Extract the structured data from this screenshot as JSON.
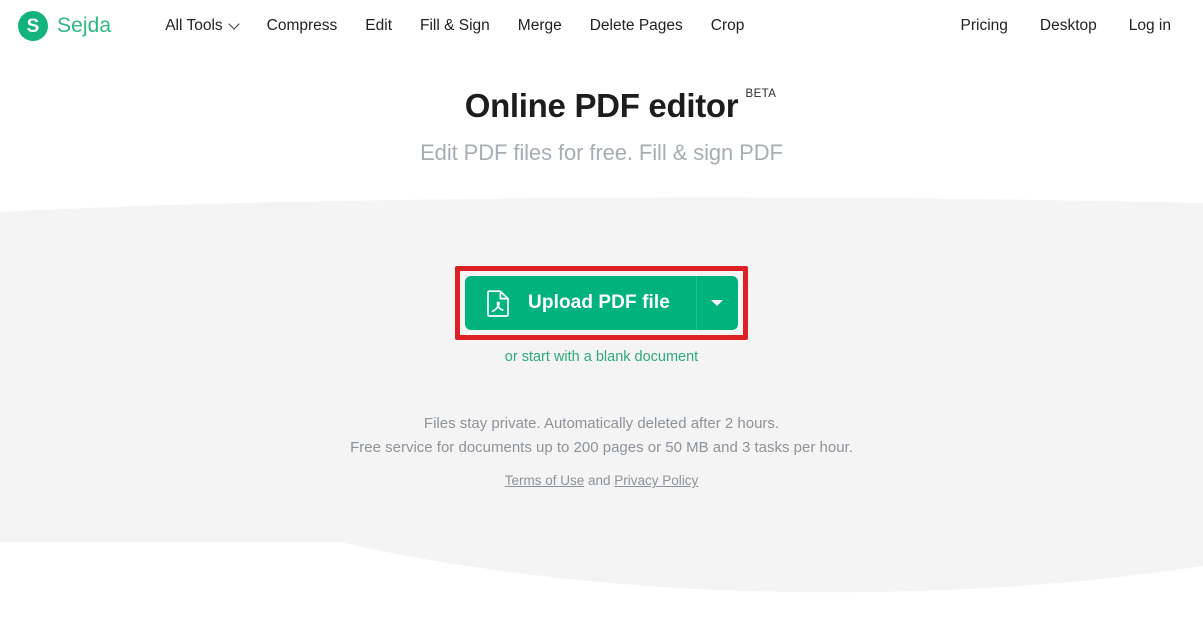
{
  "brand": {
    "mark_letter": "S",
    "name": "Sejda"
  },
  "nav": {
    "main": [
      {
        "label": "All Tools",
        "has_caret": true
      },
      {
        "label": "Compress",
        "has_caret": false
      },
      {
        "label": "Edit",
        "has_caret": false
      },
      {
        "label": "Fill & Sign",
        "has_caret": false
      },
      {
        "label": "Merge",
        "has_caret": false
      },
      {
        "label": "Delete Pages",
        "has_caret": false
      },
      {
        "label": "Crop",
        "has_caret": false
      }
    ],
    "right": [
      {
        "label": "Pricing"
      },
      {
        "label": "Desktop"
      },
      {
        "label": "Log in"
      }
    ]
  },
  "hero": {
    "title": "Online PDF editor",
    "badge": "BETA",
    "subtitle": "Edit PDF files for free. Fill & sign PDF"
  },
  "upload": {
    "button_label": "Upload PDF file",
    "icon": "pdf-file-icon",
    "dropdown_icon": "caret-down-icon",
    "blank_document_link": "or start with a blank document",
    "highlight_color": "#dd2025",
    "button_color": "#00b37e"
  },
  "notes": {
    "line1": "Files stay private. Automatically deleted after 2 hours.",
    "line2": "Free service for documents up to 200 pages or 50 MB and 3 tasks per hour.",
    "legal_terms": "Terms of Use",
    "legal_and": " and ",
    "legal_privacy": "Privacy Policy"
  },
  "colors": {
    "brand_green": "#2fb87f",
    "accent_green": "#00b37e",
    "band_gray": "#f4f4f4",
    "muted_text": "#8d9399"
  }
}
